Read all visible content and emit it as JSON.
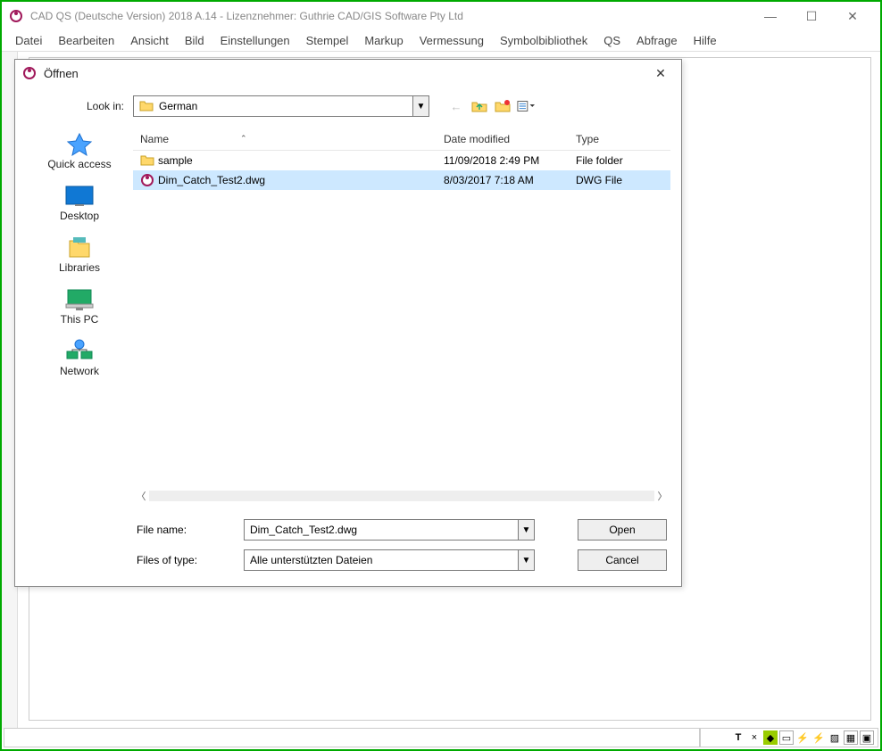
{
  "window": {
    "title": "CAD QS (Deutsche Version) 2018 A.14 - Lizenznehmer: Guthrie CAD/GIS Software Pty Ltd"
  },
  "menu": {
    "items": [
      "Datei",
      "Bearbeiten",
      "Ansicht",
      "Bild",
      "Einstellungen",
      "Stempel",
      "Markup",
      "Vermessung",
      "Symbolbibliothek",
      "QS",
      "Abfrage",
      "Hilfe"
    ]
  },
  "dialog": {
    "title": "Öffnen",
    "lookin_label": "Look in:",
    "lookin_value": "German",
    "columns": {
      "name": "Name",
      "date": "Date modified",
      "type": "Type"
    },
    "rows": [
      {
        "icon": "folder",
        "name": "sample",
        "date": "11/09/2018 2:49 PM",
        "type": "File folder",
        "selected": false
      },
      {
        "icon": "dwg",
        "name": "Dim_Catch_Test2.dwg",
        "date": "8/03/2017 7:18 AM",
        "type": "DWG File",
        "selected": true
      }
    ],
    "filename_label": "File name:",
    "filename_value": "Dim_Catch_Test2.dwg",
    "filetype_label": "Files of type:",
    "filetype_value": "Alle unterstützten Dateien",
    "open_btn": "Open",
    "cancel_btn": "Cancel",
    "places": {
      "quick": "Quick access",
      "desktop": "Desktop",
      "libraries": "Libraries",
      "thispc": "This PC",
      "network": "Network"
    }
  },
  "status": {
    "t": "T",
    "x": "×"
  }
}
